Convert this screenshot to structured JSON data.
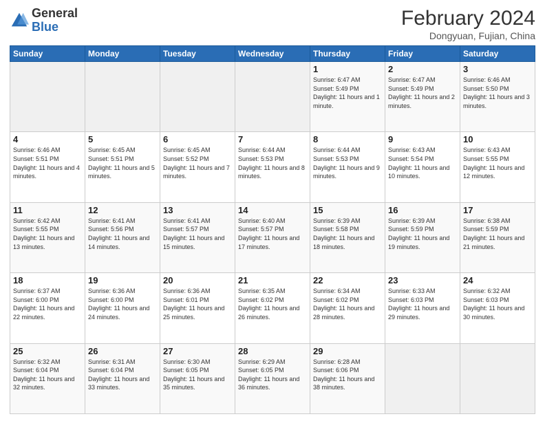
{
  "header": {
    "logo_general": "General",
    "logo_blue": "Blue",
    "title": "February 2024",
    "subtitle": "Dongyuan, Fujian, China"
  },
  "days_of_week": [
    "Sunday",
    "Monday",
    "Tuesday",
    "Wednesday",
    "Thursday",
    "Friday",
    "Saturday"
  ],
  "weeks": [
    [
      {
        "day": "",
        "info": ""
      },
      {
        "day": "",
        "info": ""
      },
      {
        "day": "",
        "info": ""
      },
      {
        "day": "",
        "info": ""
      },
      {
        "day": "1",
        "info": "Sunrise: 6:47 AM\nSunset: 5:49 PM\nDaylight: 11 hours and 1 minute."
      },
      {
        "day": "2",
        "info": "Sunrise: 6:47 AM\nSunset: 5:49 PM\nDaylight: 11 hours and 2 minutes."
      },
      {
        "day": "3",
        "info": "Sunrise: 6:46 AM\nSunset: 5:50 PM\nDaylight: 11 hours and 3 minutes."
      }
    ],
    [
      {
        "day": "4",
        "info": "Sunrise: 6:46 AM\nSunset: 5:51 PM\nDaylight: 11 hours and 4 minutes."
      },
      {
        "day": "5",
        "info": "Sunrise: 6:45 AM\nSunset: 5:51 PM\nDaylight: 11 hours and 5 minutes."
      },
      {
        "day": "6",
        "info": "Sunrise: 6:45 AM\nSunset: 5:52 PM\nDaylight: 11 hours and 7 minutes."
      },
      {
        "day": "7",
        "info": "Sunrise: 6:44 AM\nSunset: 5:53 PM\nDaylight: 11 hours and 8 minutes."
      },
      {
        "day": "8",
        "info": "Sunrise: 6:44 AM\nSunset: 5:53 PM\nDaylight: 11 hours and 9 minutes."
      },
      {
        "day": "9",
        "info": "Sunrise: 6:43 AM\nSunset: 5:54 PM\nDaylight: 11 hours and 10 minutes."
      },
      {
        "day": "10",
        "info": "Sunrise: 6:43 AM\nSunset: 5:55 PM\nDaylight: 11 hours and 12 minutes."
      }
    ],
    [
      {
        "day": "11",
        "info": "Sunrise: 6:42 AM\nSunset: 5:55 PM\nDaylight: 11 hours and 13 minutes."
      },
      {
        "day": "12",
        "info": "Sunrise: 6:41 AM\nSunset: 5:56 PM\nDaylight: 11 hours and 14 minutes."
      },
      {
        "day": "13",
        "info": "Sunrise: 6:41 AM\nSunset: 5:57 PM\nDaylight: 11 hours and 15 minutes."
      },
      {
        "day": "14",
        "info": "Sunrise: 6:40 AM\nSunset: 5:57 PM\nDaylight: 11 hours and 17 minutes."
      },
      {
        "day": "15",
        "info": "Sunrise: 6:39 AM\nSunset: 5:58 PM\nDaylight: 11 hours and 18 minutes."
      },
      {
        "day": "16",
        "info": "Sunrise: 6:39 AM\nSunset: 5:59 PM\nDaylight: 11 hours and 19 minutes."
      },
      {
        "day": "17",
        "info": "Sunrise: 6:38 AM\nSunset: 5:59 PM\nDaylight: 11 hours and 21 minutes."
      }
    ],
    [
      {
        "day": "18",
        "info": "Sunrise: 6:37 AM\nSunset: 6:00 PM\nDaylight: 11 hours and 22 minutes."
      },
      {
        "day": "19",
        "info": "Sunrise: 6:36 AM\nSunset: 6:00 PM\nDaylight: 11 hours and 24 minutes."
      },
      {
        "day": "20",
        "info": "Sunrise: 6:36 AM\nSunset: 6:01 PM\nDaylight: 11 hours and 25 minutes."
      },
      {
        "day": "21",
        "info": "Sunrise: 6:35 AM\nSunset: 6:02 PM\nDaylight: 11 hours and 26 minutes."
      },
      {
        "day": "22",
        "info": "Sunrise: 6:34 AM\nSunset: 6:02 PM\nDaylight: 11 hours and 28 minutes."
      },
      {
        "day": "23",
        "info": "Sunrise: 6:33 AM\nSunset: 6:03 PM\nDaylight: 11 hours and 29 minutes."
      },
      {
        "day": "24",
        "info": "Sunrise: 6:32 AM\nSunset: 6:03 PM\nDaylight: 11 hours and 30 minutes."
      }
    ],
    [
      {
        "day": "25",
        "info": "Sunrise: 6:32 AM\nSunset: 6:04 PM\nDaylight: 11 hours and 32 minutes."
      },
      {
        "day": "26",
        "info": "Sunrise: 6:31 AM\nSunset: 6:04 PM\nDaylight: 11 hours and 33 minutes."
      },
      {
        "day": "27",
        "info": "Sunrise: 6:30 AM\nSunset: 6:05 PM\nDaylight: 11 hours and 35 minutes."
      },
      {
        "day": "28",
        "info": "Sunrise: 6:29 AM\nSunset: 6:05 PM\nDaylight: 11 hours and 36 minutes."
      },
      {
        "day": "29",
        "info": "Sunrise: 6:28 AM\nSunset: 6:06 PM\nDaylight: 11 hours and 38 minutes."
      },
      {
        "day": "",
        "info": ""
      },
      {
        "day": "",
        "info": ""
      }
    ]
  ]
}
